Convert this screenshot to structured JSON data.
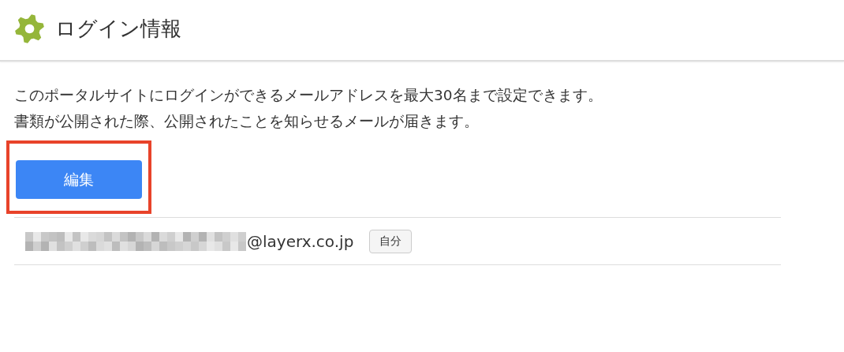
{
  "header": {
    "title": "ログイン情報"
  },
  "description": [
    "このポータルサイトにログインができるメールアドレスを最大30名まで設定できます。",
    "書類が公開された際、公開されたことを知らせるメールが届きます。"
  ],
  "edit_button": {
    "label": "編集",
    "highlighted": true
  },
  "members": [
    {
      "email": "@layerx.co.jp",
      "redacted": true,
      "tag": "自分"
    }
  ]
}
